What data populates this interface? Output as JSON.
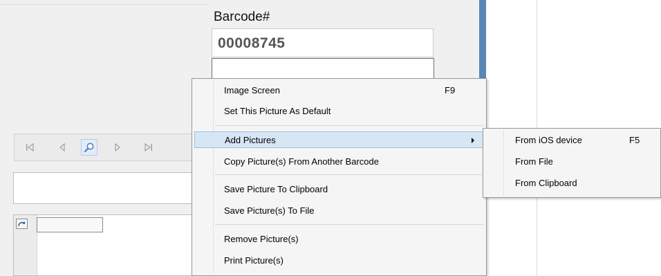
{
  "record": {
    "barcode_label": "Barcode#",
    "barcode_value": "00008745"
  },
  "context_menu": {
    "items": [
      {
        "label": "Image Screen",
        "shortcut": "F9"
      },
      {
        "label": "Set This Picture As Default",
        "shortcut": ""
      },
      {
        "label": "Add Pictures",
        "shortcut": ""
      },
      {
        "label": "Copy Picture(s) From Another Barcode",
        "shortcut": ""
      },
      {
        "label": "Save Picture To Clipboard",
        "shortcut": ""
      },
      {
        "label": "Save Picture(s) To File",
        "shortcut": ""
      },
      {
        "label": "Remove Picture(s)",
        "shortcut": ""
      },
      {
        "label": "Print Picture(s)",
        "shortcut": ""
      }
    ],
    "highlighted": "Add Pictures"
  },
  "submenu": {
    "items": [
      {
        "label": "From iOS device",
        "shortcut": "F5"
      },
      {
        "label": "From File",
        "shortcut": ""
      },
      {
        "label": "From Clipboard",
        "shortcut": ""
      }
    ]
  },
  "nav_toolbar": {
    "icons": [
      "first-record-icon",
      "previous-record-icon",
      "zoom-icon",
      "next-record-icon",
      "last-record-icon"
    ]
  },
  "colors": {
    "accent_bar": "#5b86b4",
    "menu_highlight": "#d7e6f5"
  }
}
